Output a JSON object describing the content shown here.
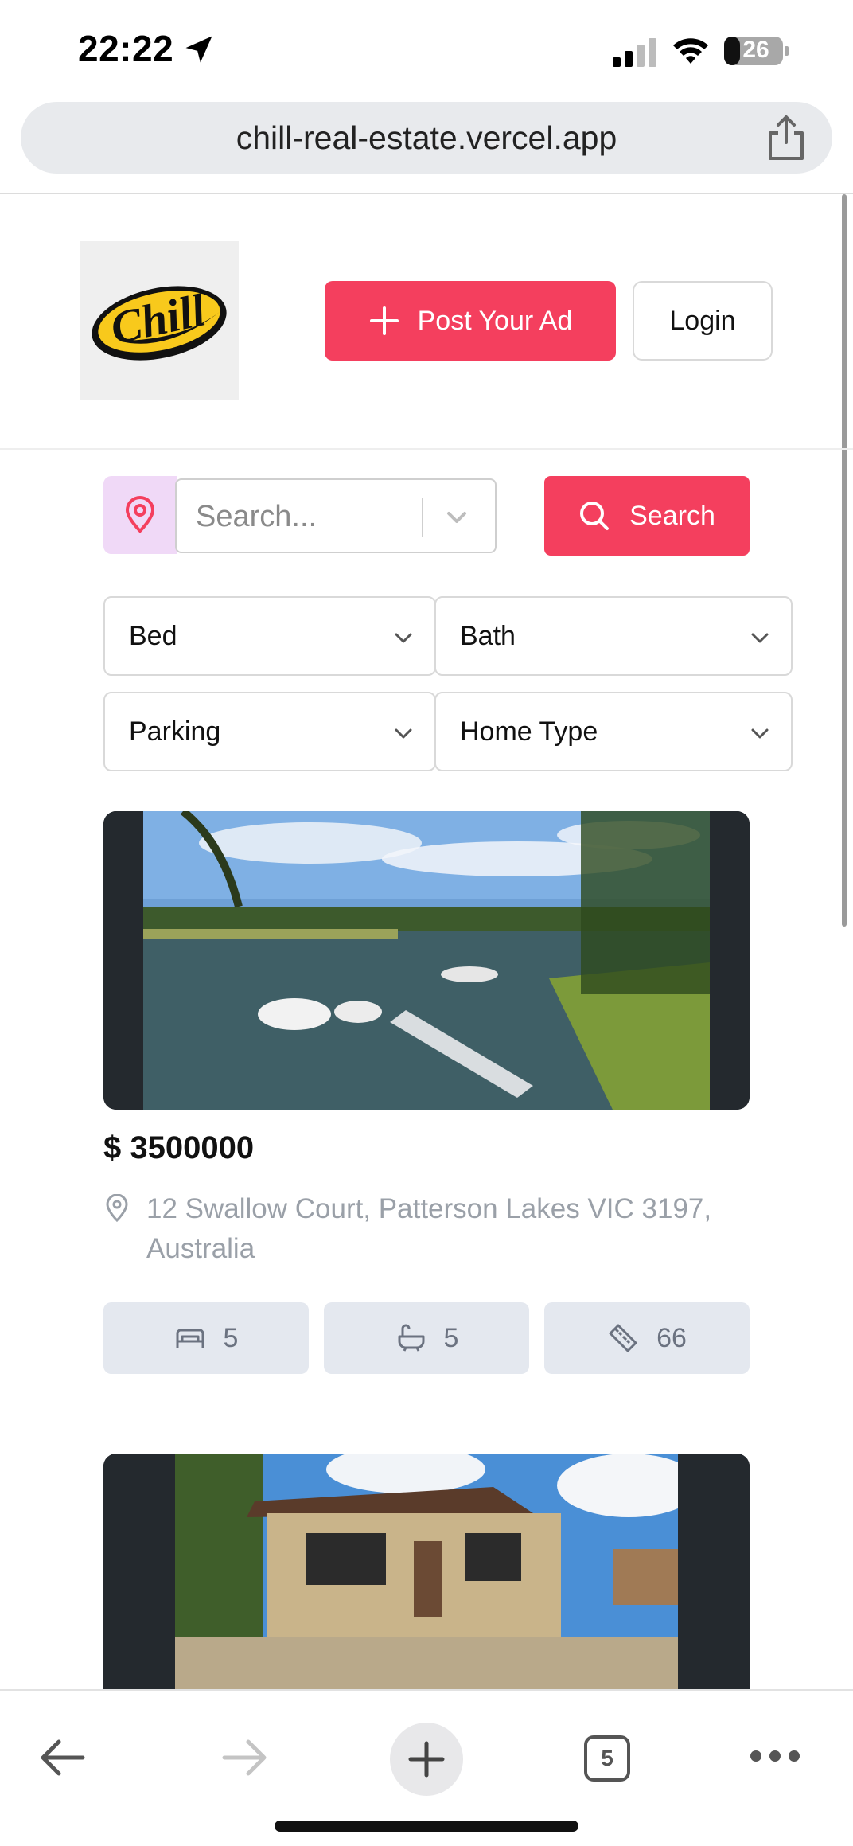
{
  "status_bar": {
    "time": "22:22",
    "battery": "26"
  },
  "browser": {
    "url": "chill-real-estate.vercel.app",
    "open_tabs": "5"
  },
  "header": {
    "logo_text": "Chill",
    "post_ad_label": "Post Your Ad",
    "login_label": "Login"
  },
  "search": {
    "placeholder": "Search...",
    "button_label": "Search"
  },
  "filters": {
    "bed": "Bed",
    "bath": "Bath",
    "parking": "Parking",
    "home_type": "Home Type"
  },
  "listings": [
    {
      "price": "$ 3500000",
      "address": "12 Swallow Court, Patterson Lakes VIC 3197, Australia",
      "beds": "5",
      "baths": "5",
      "area": "66"
    }
  ],
  "colors": {
    "accent": "#f43f5e",
    "location_box": "#f0d9f7",
    "chip_bg": "#e4e8ef"
  }
}
